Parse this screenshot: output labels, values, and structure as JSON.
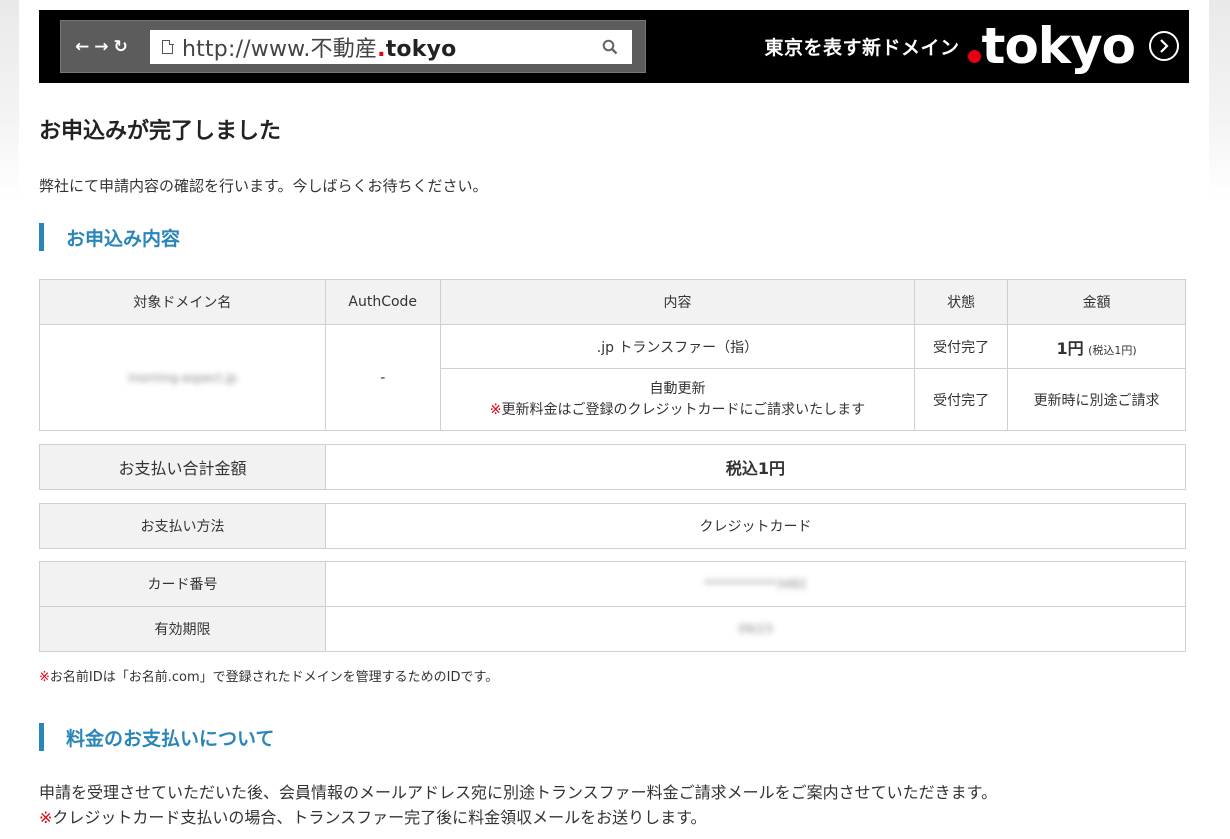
{
  "banner": {
    "url_prefix": "http://www.不動産",
    "url_dot": ".",
    "url_tld": "tokyo",
    "tagline": "東京を表す新ドメイン",
    "logo_word": "tokyo",
    "nav_back": "←",
    "nav_forward": "→",
    "nav_reload": "↻"
  },
  "title": "お申込みが完了しました",
  "lead": "弊社にて申請内容の確認を行います。今しばらくお待ちください。",
  "section1": {
    "heading": "お申込み内容"
  },
  "order_table": {
    "headers": [
      "対象ドメイン名",
      "AuthCode",
      "内容",
      "状態",
      "金額"
    ],
    "domain_name": "morning-aspect.jp",
    "authcode": "-",
    "rows": [
      {
        "content": ".jp トランスファー（指）",
        "status": "受付完了",
        "price_main": "1円",
        "price_note": "(税込1円)"
      },
      {
        "content_line1": "自動更新",
        "content_mark": "※",
        "content_line2": "更新料金はご登録のクレジットカードにご請求いたします",
        "status": "受付完了",
        "price": "更新時に別途ご請求"
      }
    ]
  },
  "total": {
    "label": "お支払い合計金額",
    "value": "税込1円"
  },
  "payment": {
    "label": "お支払い方法",
    "value": "クレジットカード"
  },
  "card": {
    "number_label": "カード番号",
    "number_value": "************3482",
    "expiry_label": "有効期限",
    "expiry_value": "09/23"
  },
  "footnote": {
    "mark": "※",
    "text": "お名前IDは「お名前.com」で登録されたドメインを管理するためのIDです。"
  },
  "section2": {
    "heading": "料金のお支払いについて"
  },
  "payment_info": {
    "line1": "申請を受理させていただいた後、会員情報のメールアドレス宛に別途トランスファー料金ご請求メールをご案内させていただきます。",
    "line2_mark": "※",
    "line2": "クレジットカード支払いの場合、トランスファー完了後に料金領収メールをお送りします。"
  }
}
